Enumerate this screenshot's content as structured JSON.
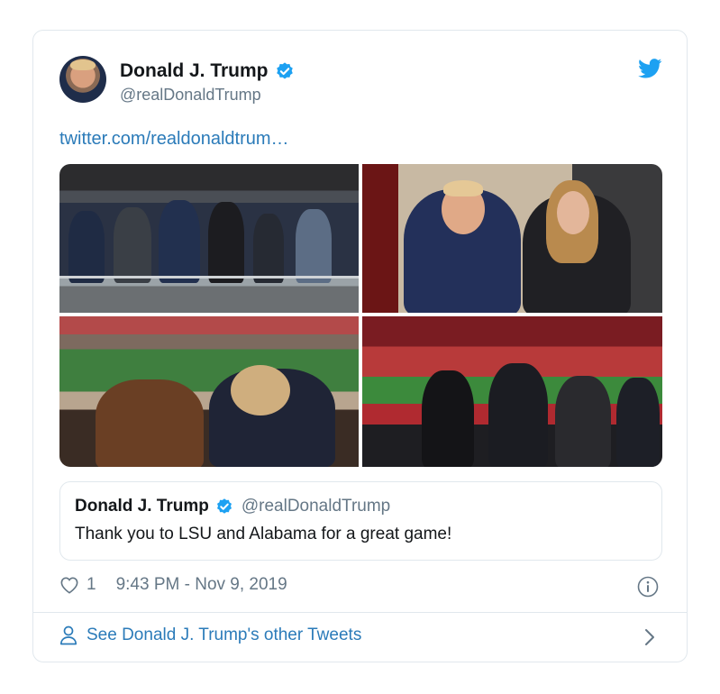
{
  "tweet": {
    "author_name": "Donald J. Trump",
    "author_handle": "@realDonaldTrump",
    "link_text": "twitter.com/realdonaldtrum…",
    "likes": "1",
    "timestamp": "9:43 PM - Nov 9, 2019"
  },
  "quoted_tweet": {
    "author_name": "Donald J. Trump",
    "author_handle": "@realDonaldTrump",
    "text": "Thank you to LSU and Alabama for a great game!"
  },
  "footer": {
    "label": "See Donald J. Trump's other Tweets"
  },
  "icons": {
    "verified": "verified-badge-icon",
    "brand": "twitter-bird-icon",
    "like": "heart-icon",
    "info": "info-icon",
    "profile": "person-icon",
    "more": "chevron-right-icon"
  },
  "colors": {
    "accent": "#1da1f2",
    "link": "#2b7bb9",
    "secondary_text": "#657786",
    "border": "#e1e8ed"
  }
}
